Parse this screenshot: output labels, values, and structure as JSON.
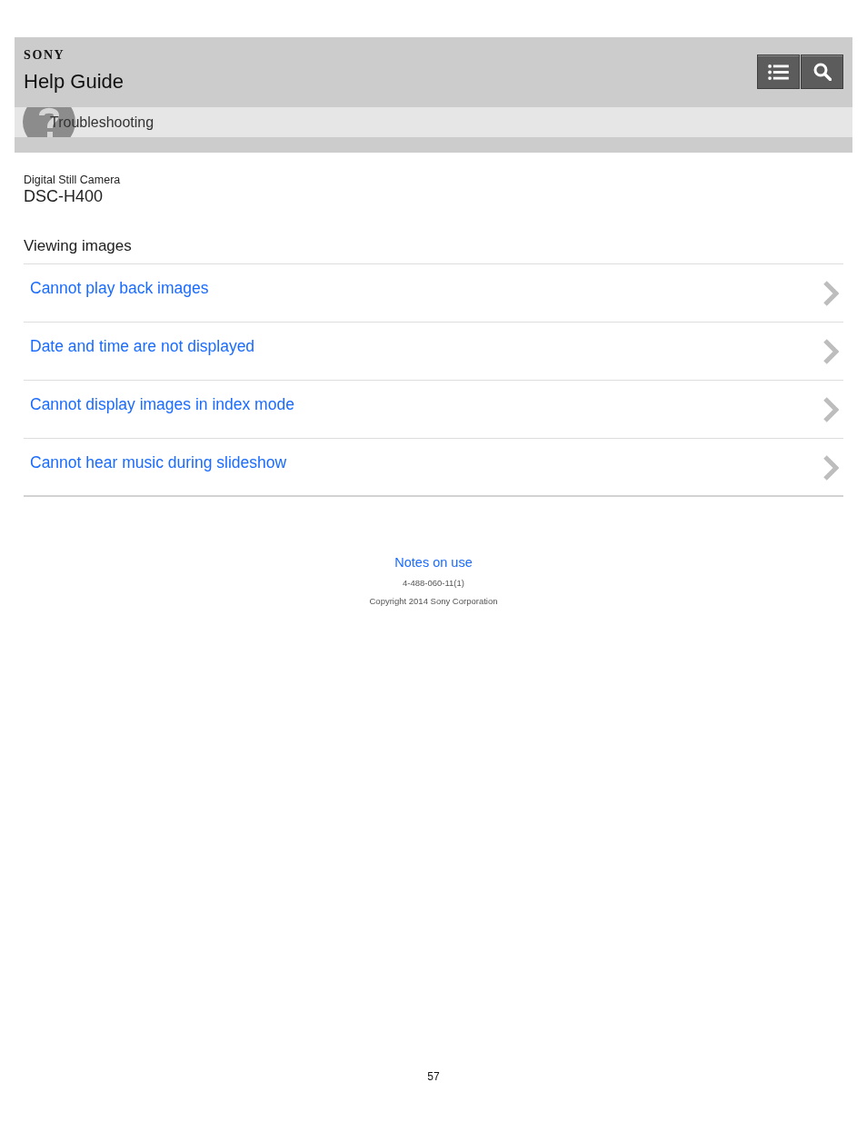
{
  "header": {
    "brand": "SONY",
    "title": "Help Guide",
    "tool_buttons": [
      {
        "kind": "list"
      },
      {
        "kind": "search"
      }
    ]
  },
  "breadcrumb": {
    "label": "Troubleshooting"
  },
  "product": {
    "category": "Digital Still Camera",
    "model": "DSC-H400"
  },
  "section": {
    "heading": "Viewing images",
    "links": [
      "Cannot play back images",
      "Date and time are not displayed",
      "Cannot display images in index mode",
      "Cannot hear music during slideshow"
    ]
  },
  "footer": {
    "link": "Notes on use",
    "code": "4-488-060-11(1)",
    "copyright": "Copyright 2014 Sony Corporation"
  },
  "page_number": "57"
}
